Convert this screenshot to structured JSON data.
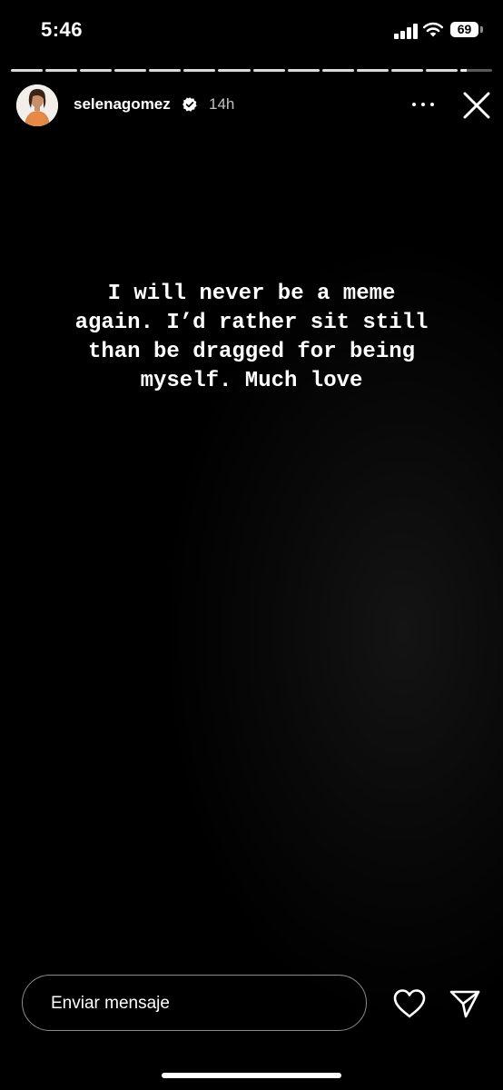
{
  "status_bar": {
    "time": "5:46",
    "battery_level": "69",
    "signal_icon": "cellular-signal-icon",
    "wifi_icon": "wifi-icon"
  },
  "progress": {
    "total_segments": 14,
    "current_segment": 13,
    "current_fraction": 0.2
  },
  "header": {
    "username": "selenagomez",
    "time_ago": "14h",
    "verified_icon": "verified-badge-icon",
    "more_icon": "more-dots-icon",
    "close_icon": "close-icon"
  },
  "story": {
    "lines": [
      "I will never be a meme",
      "again. I’d rather sit still",
      "than be dragged for being",
      "myself. Much love"
    ]
  },
  "footer": {
    "message_placeholder": "Enviar mensaje",
    "like_icon": "heart-icon",
    "send_icon": "send-icon"
  },
  "colors": {
    "background": "#000000",
    "text": "#ffffff",
    "verified_badge": "#ffffff"
  }
}
